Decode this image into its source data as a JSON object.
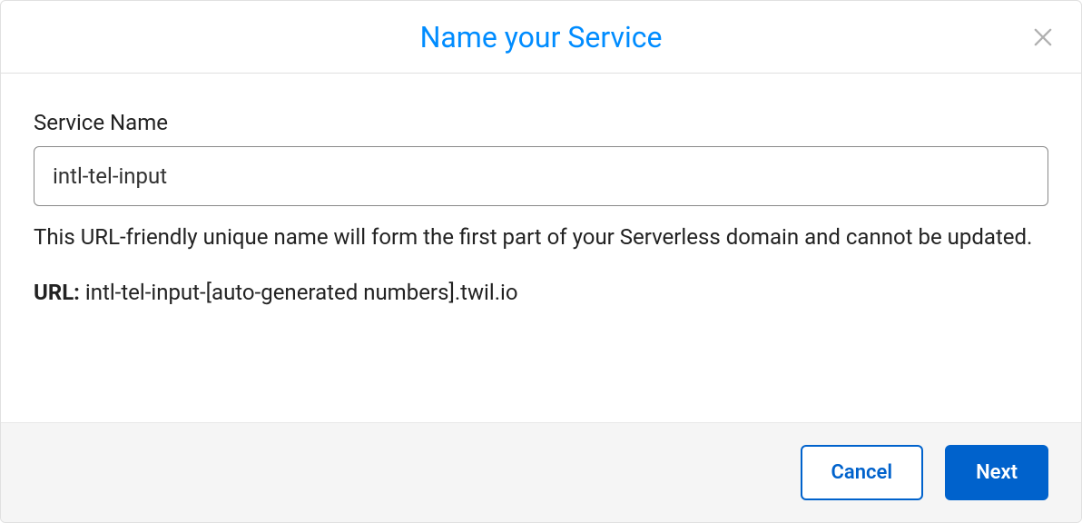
{
  "modal": {
    "title": "Name your Service",
    "close_icon": "close"
  },
  "form": {
    "service_name_label": "Service Name",
    "service_name_value": "intl-tel-input",
    "help_text": "This URL-friendly unique name will form the first part of your Serverless domain and cannot be updated.",
    "url_label": "URL:",
    "url_value": "intl-tel-input-[auto-generated numbers].twil.io"
  },
  "footer": {
    "cancel_label": "Cancel",
    "next_label": "Next"
  }
}
